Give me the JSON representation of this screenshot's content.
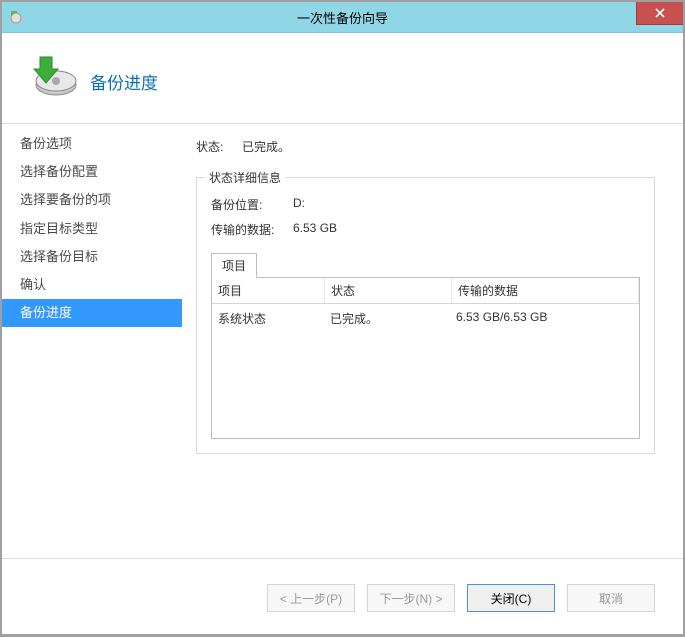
{
  "window": {
    "title": "一次性备份向导"
  },
  "header": {
    "title": "备份进度"
  },
  "sidebar": {
    "items": [
      {
        "label": "备份选项",
        "selected": false
      },
      {
        "label": "选择备份配置",
        "selected": false
      },
      {
        "label": "选择要备份的项",
        "selected": false
      },
      {
        "label": "指定目标类型",
        "selected": false
      },
      {
        "label": "选择备份目标",
        "selected": false
      },
      {
        "label": "确认",
        "selected": false
      },
      {
        "label": "备份进度",
        "selected": true
      }
    ]
  },
  "content": {
    "status_label": "状态:",
    "status_value": "已完成。",
    "details_group_title": "状态详细信息",
    "location_label": "备份位置:",
    "location_value": "D:",
    "transferred_label": "传输的数据:",
    "transferred_value": "6.53 GB",
    "tab_label": "项目",
    "table": {
      "headers": {
        "item": "项目",
        "state": "状态",
        "transferred": "传输的数据"
      },
      "rows": [
        {
          "item": "系统状态",
          "state": "已完成。",
          "transferred": "6.53 GB/6.53 GB"
        }
      ]
    }
  },
  "footer": {
    "back": "< 上一步(P)",
    "next": "下一步(N) >",
    "close": "关闭(C)",
    "cancel": "取消"
  }
}
